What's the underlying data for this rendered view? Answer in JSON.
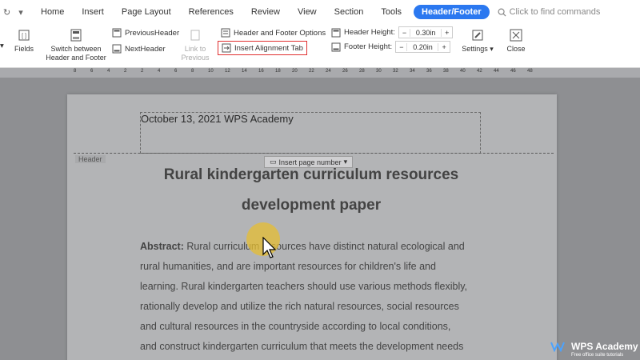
{
  "menubar": {
    "tabs": [
      "Home",
      "Insert",
      "Page Layout",
      "References",
      "Review",
      "View",
      "Section",
      "Tools"
    ],
    "active_tab": "Header/Footer",
    "search_placeholder": "Click to find commands"
  },
  "ribbon": {
    "fields": "Fields",
    "switch_line1": "Switch between",
    "switch_line2": "Header and Footer",
    "previous_header": "PreviousHeader",
    "next_header": "NextHeader",
    "link_line1": "Link to",
    "link_line2": "Previous",
    "hf_options": "Header and Footer Options",
    "insert_alignment_tab": "Insert Alignment Tab",
    "header_height_label": "Header Height:",
    "header_height_value": "0.30in",
    "footer_height_label": "Footer Height:",
    "footer_height_value": "0.20in",
    "settings": "Settings",
    "close": "Close"
  },
  "ruler": {
    "ticks": [
      "8",
      "6",
      "4",
      "2",
      "2",
      "4",
      "6",
      "8",
      "10",
      "12",
      "14",
      "16",
      "18",
      "20",
      "22",
      "24",
      "26",
      "28",
      "30",
      "32",
      "34",
      "36",
      "38",
      "40",
      "42",
      "44",
      "46",
      "48"
    ]
  },
  "document": {
    "header_text": "October 13, 2021 WPS Academy",
    "header_label": "Header",
    "insert_page_number": "Insert page number",
    "title_line1": "Rural kindergarten curriculum resources",
    "title_line2": "development paper",
    "abstract_label": "Abstract:",
    "paragraph_lines": [
      " Rural curriculum resources have distinct natural ecological and",
      "rural humanities, and are important resources for children's life and",
      "learning. Rural kindergarten teachers should use various methods flexibly,",
      "rationally develop and utilize the rich natural resources, social resources",
      "and cultural resources in the countryside according to local conditions,",
      "and construct kindergarten curriculum that meets the development needs"
    ]
  },
  "logo": {
    "name": "WPS Academy",
    "tagline": "Free office suite tutorials"
  }
}
